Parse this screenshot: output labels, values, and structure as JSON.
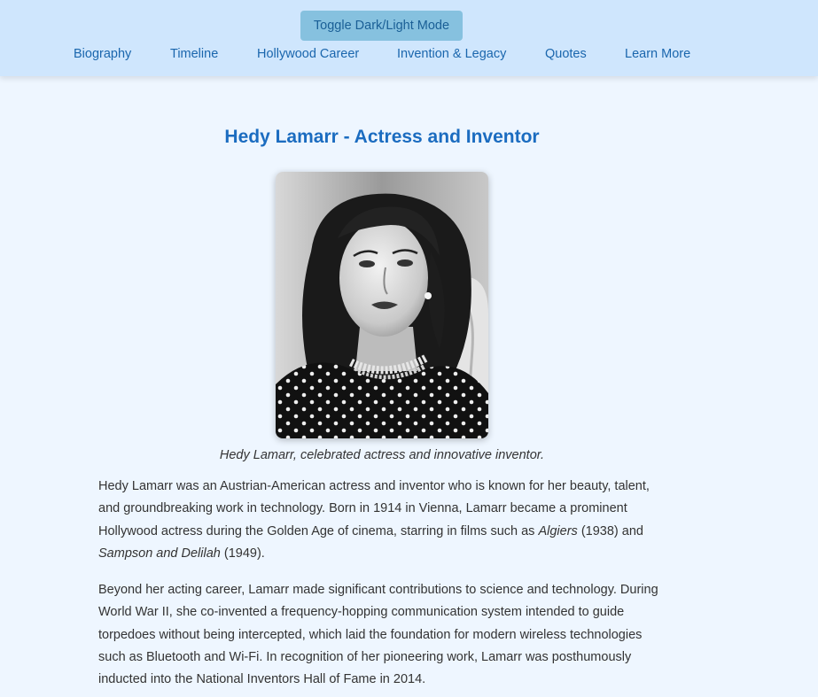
{
  "header": {
    "toggle_label": "Toggle Dark/Light Mode",
    "nav": [
      {
        "label": "Biography"
      },
      {
        "label": "Timeline"
      },
      {
        "label": "Hollywood Career"
      },
      {
        "label": "Invention & Legacy"
      },
      {
        "label": "Quotes"
      },
      {
        "label": "Learn More"
      }
    ]
  },
  "main": {
    "title": "Hedy Lamarr - Actress and Inventor",
    "image_alt": "portrait-photo",
    "caption": "Hedy Lamarr, celebrated actress and innovative inventor.",
    "paragraph1": {
      "a": "Hedy Lamarr was an Austrian-American actress and inventor who is known for her beauty, talent, and groundbreaking work in technology. Born in 1914 in Vienna, Lamarr became a prominent Hollywood actress during the Golden Age of cinema, starring in films such as ",
      "film1": "Algiers",
      "b": " (1938) and ",
      "film2": "Sampson and Delilah",
      "c": " (1949)."
    },
    "paragraph2": "Beyond her acting career, Lamarr made significant contributions to science and technology. During World War II, she co-invented a frequency-hopping communication system intended to guide torpedoes without being intercepted, which laid the foundation for modern wireless technologies such as Bluetooth and Wi-Fi. In recognition of her pioneering work, Lamarr was posthumously inducted into the National Inventors Hall of Fame in 2014."
  },
  "colors": {
    "header_bg": "#cfe6fd",
    "page_bg": "#eef6ff",
    "accent": "#1b6cc0",
    "button_bg": "#86c1df"
  }
}
